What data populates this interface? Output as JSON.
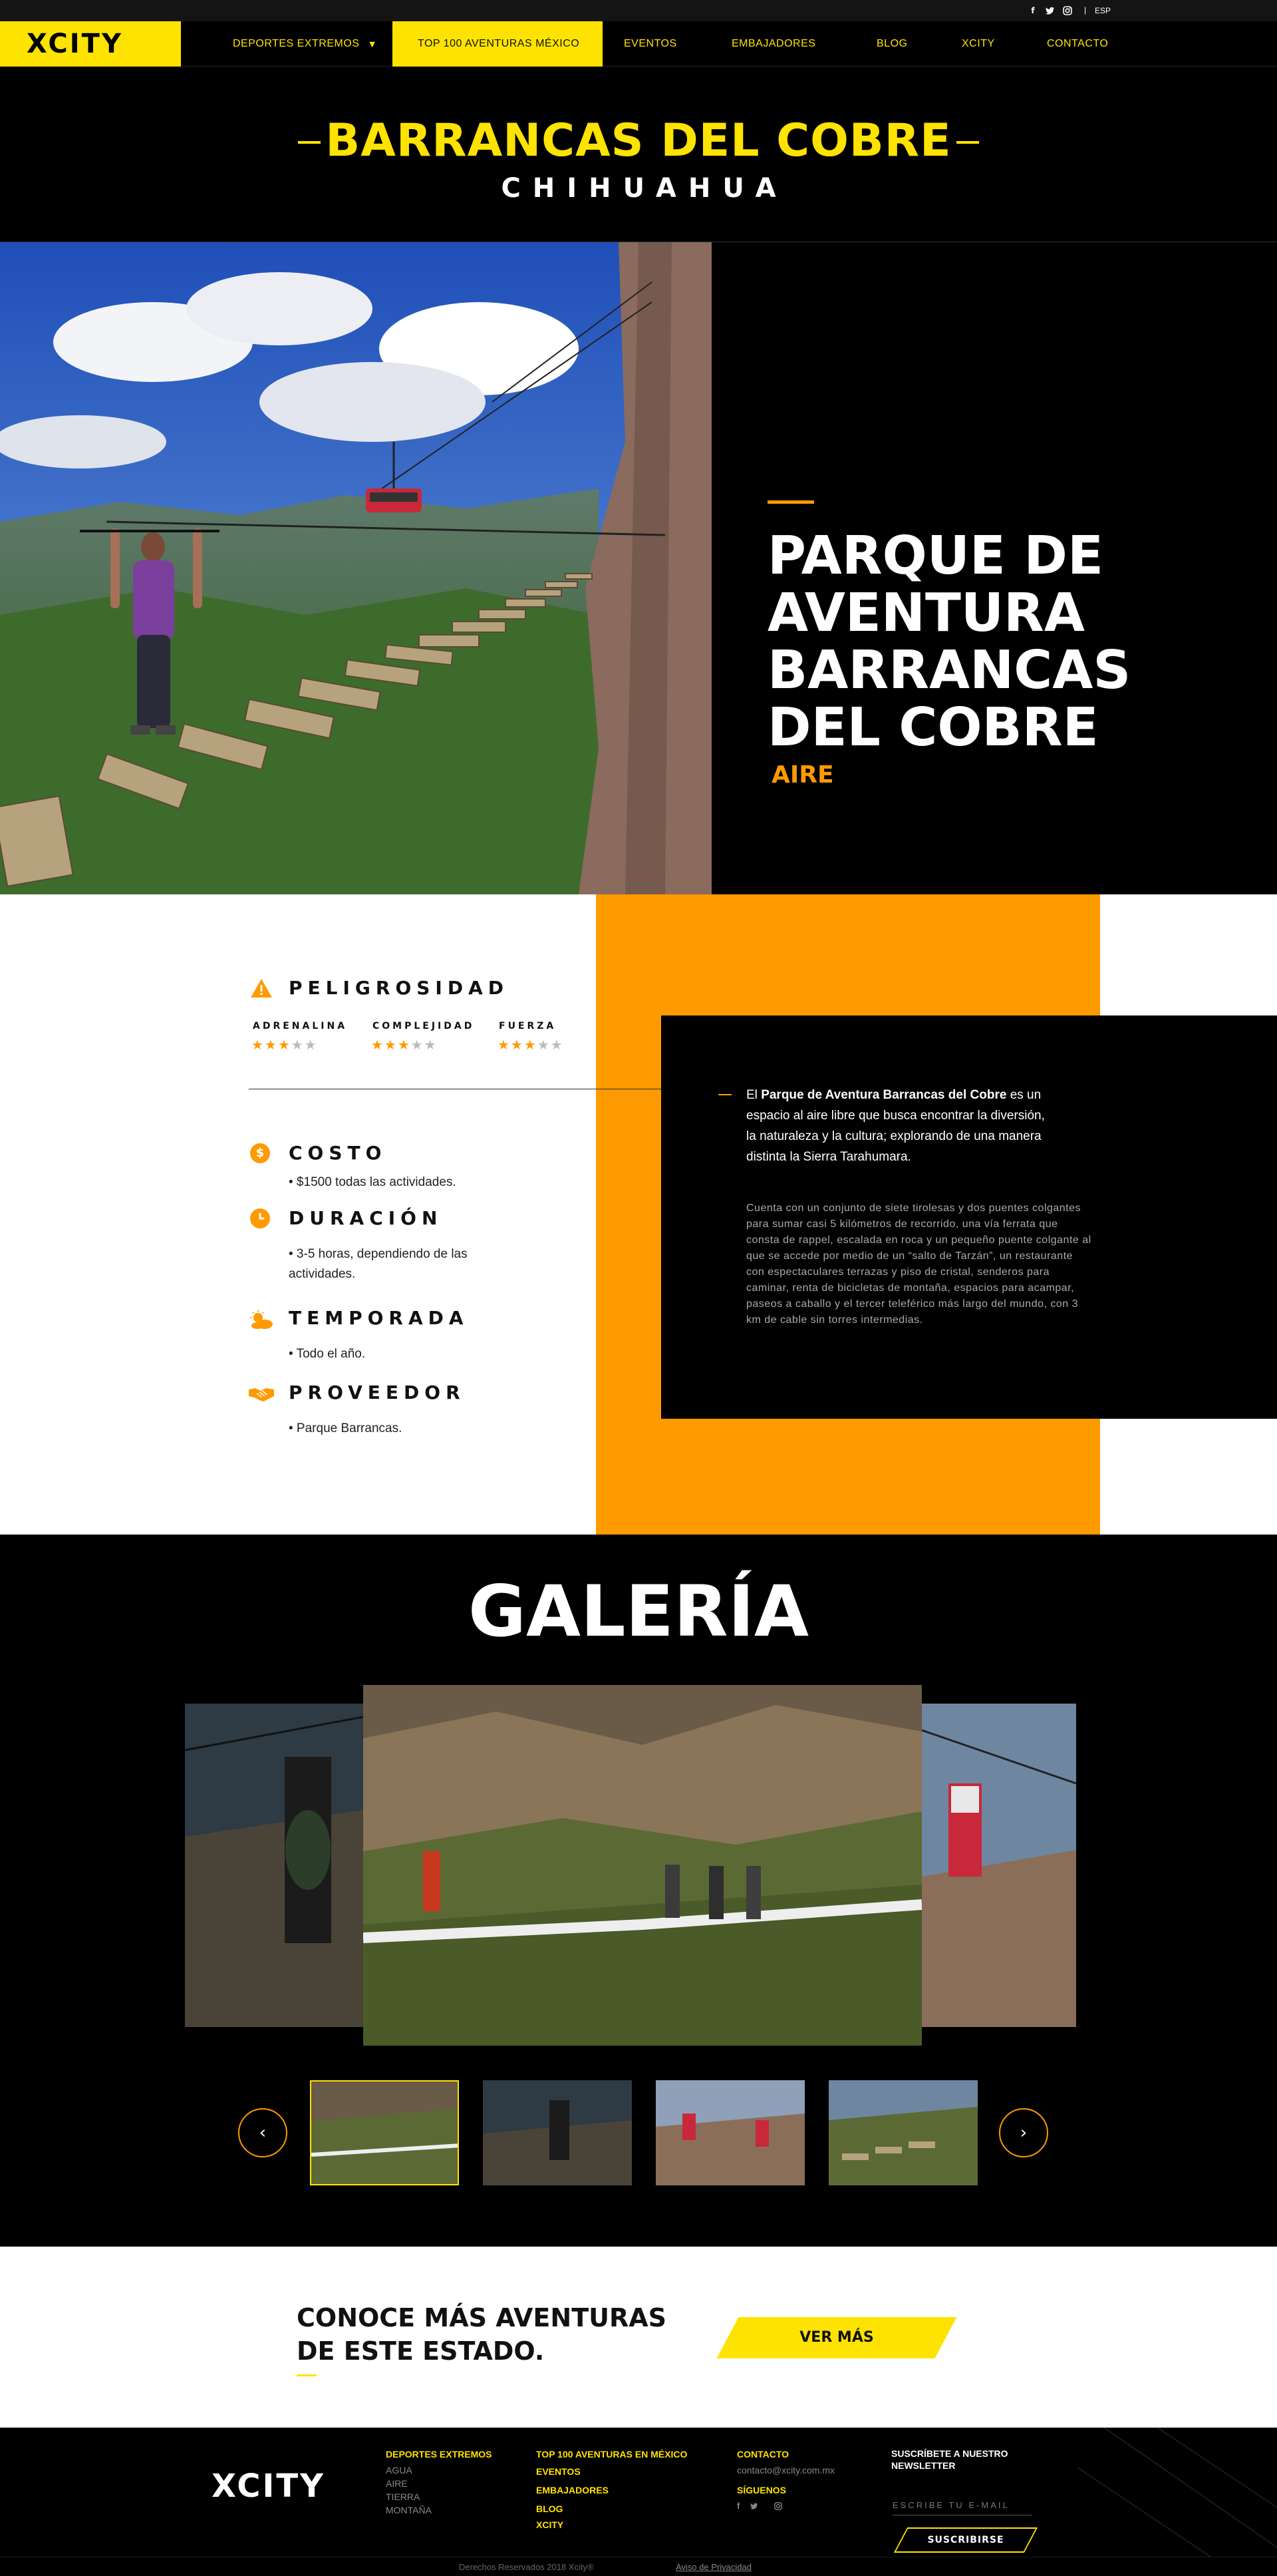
{
  "topbar": {
    "social_icons": [
      "facebook-icon",
      "twitter-icon",
      "instagram-icon"
    ],
    "separator": "|",
    "language": "ESP"
  },
  "nav": {
    "logo": "XCITY",
    "items": [
      {
        "label": "DEPORTES EXTREMOS",
        "has_dropdown": true
      },
      {
        "label": "TOP 100 AVENTURAS MÉXICO",
        "active": true
      },
      {
        "label": "EVENTOS"
      },
      {
        "label": "EMBAJADORES"
      },
      {
        "label": "BLOG"
      },
      {
        "label": "XCITY"
      },
      {
        "label": "CONTACTO"
      }
    ]
  },
  "hero": {
    "title": "BARRANCAS DEL COBRE",
    "subtitle": "CHIHUAHUA"
  },
  "park": {
    "title": "PARQUE DE AVENTURA BARRANCAS DEL COBRE",
    "category": "AIRE"
  },
  "details": {
    "danger": {
      "heading": "PELIGROSIDAD",
      "ratings": [
        {
          "label": "ADRENALINA",
          "stars": 3,
          "max": 5
        },
        {
          "label": "COMPLEJIDAD",
          "stars": 3,
          "max": 5
        },
        {
          "label": "FUERZA",
          "stars": 3,
          "max": 5
        }
      ]
    },
    "cost": {
      "heading": "COSTO",
      "text": "• $1500 todas las actividades."
    },
    "duration": {
      "heading": "DURACIÓN",
      "text": "• 3-5 horas, dependiendo de las actividades."
    },
    "season": {
      "heading": "TEMPORADA",
      "text": "• Todo el año."
    },
    "provider": {
      "heading": "PROVEEDOR",
      "text": "• Parque Barrancas."
    }
  },
  "description": {
    "p1_prefix": "El ",
    "p1_bold": "Parque de Aventura Barrancas del Cobre",
    "p1_rest": " es un espacio al aire libre que busca encontrar la diversión, la naturaleza y la cultura; explorando de una manera distinta la Sierra Tarahumara.",
    "p2": "Cuenta con un conjunto de siete tirolesas y dos puentes colgantes para sumar casi 5 kilómetros de recorrido, una vía ferrata que consta de rappel, escalada en roca y un pequeño puente colgante al que se accede por medio de un “salto de Tarzán”, un restaurante con espectaculares terrazas y piso de cristal, senderos para caminar, renta de bicicletas de montaña, espacios para acampar, paseos a caballo y el tercer teleférico más largo del mundo, con 3 km de cable sin torres intermedias."
  },
  "gallery": {
    "title": "GALERÍA",
    "prev_icon": "chevron-left-icon",
    "next_icon": "chevron-right-icon"
  },
  "more": {
    "title": "CONOCE MÁS AVENTURAS DE ESTE ESTADO.",
    "button": "VER MÁS"
  },
  "footer": {
    "logo": "XCITY",
    "col1_title": "DEPORTES EXTREMOS",
    "col1_links": [
      "AGUA",
      "AIRE",
      "TIERRA",
      "MONTAÑA"
    ],
    "col2_links": [
      "TOP 100 AVENTURAS EN MÉXICO",
      "EVENTOS",
      "EMBAJADORES",
      "BLOG",
      "XCITY"
    ],
    "contact_title": "CONTACTO",
    "contact_email": "contacto@xcity.com.mx",
    "follow_title": "SÍGUENOS",
    "newsletter_title": "SUSCRÍBETE A NUESTRO NEWSLETTER",
    "newsletter_placeholder": "ESCRIBE TU E-MAIL",
    "newsletter_button": "SUSCRIBIRSE",
    "copyright": "Derechos Reservados 2018 Xcity®",
    "privacy": "Aviso de Privacidad"
  },
  "colors": {
    "brand_yellow": "#ffe300",
    "accent_orange": "#ff9a00",
    "background": "#000000"
  }
}
